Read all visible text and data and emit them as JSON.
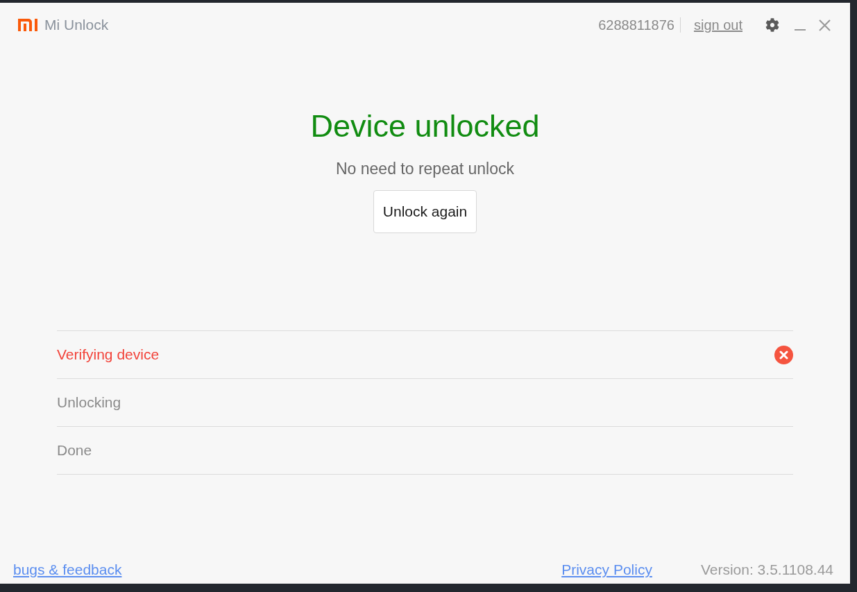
{
  "window": {
    "app_name": "Mi Unlock"
  },
  "account": {
    "id": "6288811876",
    "sign_out": "sign out"
  },
  "result": {
    "title": "Device unlocked",
    "message": "No need to repeat unlock",
    "button": "Unlock again"
  },
  "steps": [
    {
      "label": "Verifying device",
      "failed": true
    },
    {
      "label": "Unlocking",
      "failed": false
    },
    {
      "label": "Done",
      "failed": false
    }
  ],
  "footer": {
    "feedback_link": "bugs & feedback",
    "privacy_link": "Privacy Policy",
    "version": "Version: 3.5.1108.44"
  }
}
